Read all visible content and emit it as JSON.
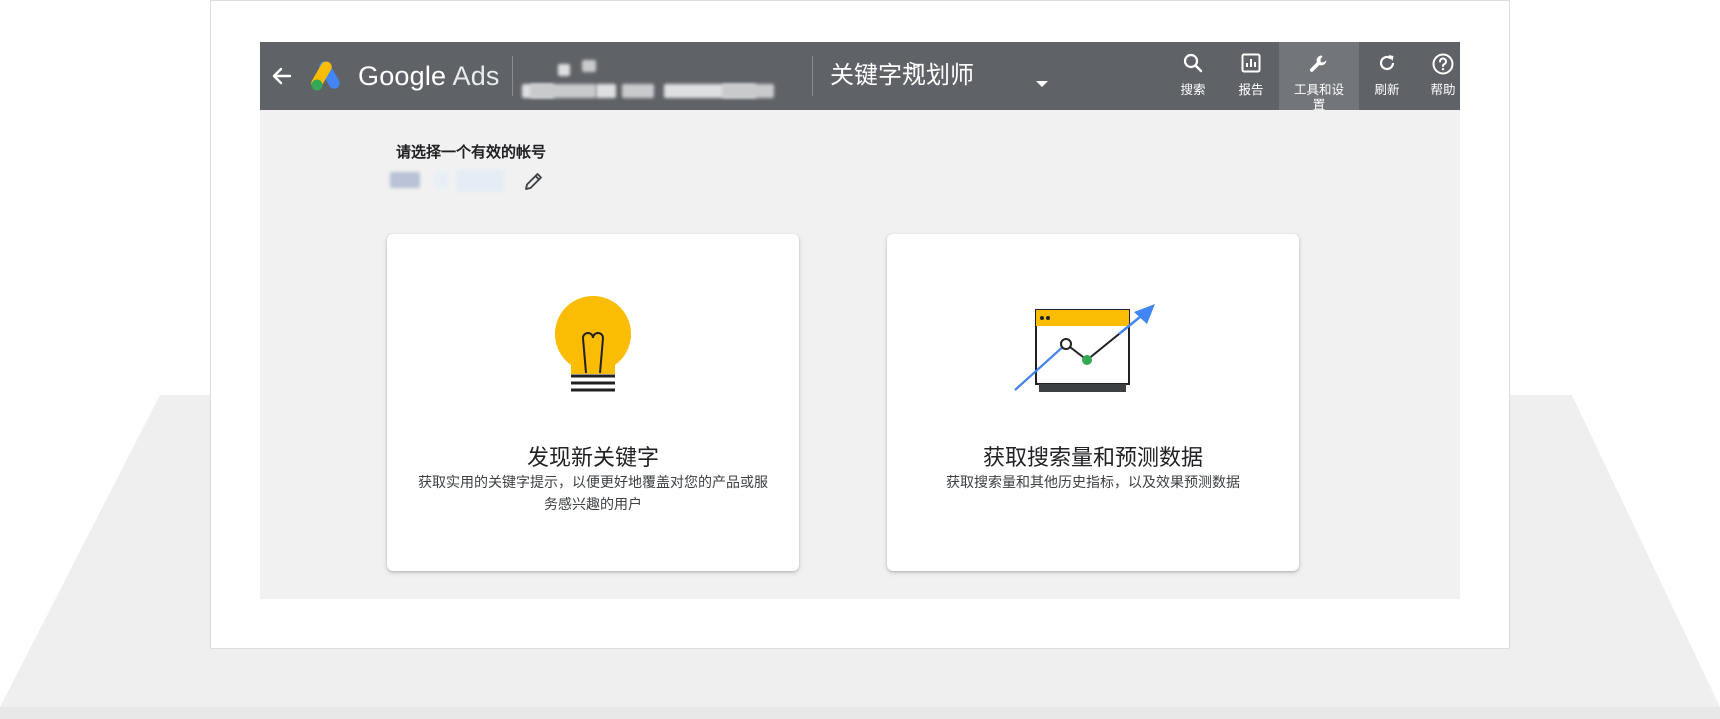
{
  "window": {
    "brand_google": "Google",
    "brand_ads": "Ads",
    "breadcrumb_chevron": ">",
    "page_title": "关键字规划师"
  },
  "nav": [
    {
      "label": "搜索",
      "icon": "search-icon"
    },
    {
      "label": "报告",
      "icon": "reports-icon"
    },
    {
      "label": "工具和设置",
      "icon": "wrench-icon"
    },
    {
      "label": "刷新",
      "icon": "refresh-icon"
    },
    {
      "label": "帮助",
      "icon": "help-icon"
    }
  ],
  "account": {
    "prompt": "请选择一个有效的帐号"
  },
  "cards": [
    {
      "title": "发现新关键字",
      "description": "获取实用的关键字提示，以便更好地覆盖对您的产品或服务感兴趣的用户",
      "icon": "lightbulb-icon"
    },
    {
      "title": "获取搜索量和预测数据",
      "description": "获取搜索量和其他历史指标，以及效果预测数据",
      "icon": "forecast-chart-icon"
    }
  ],
  "colors": {
    "topbar": "#5f6368",
    "accent_yellow": "#fbbc04",
    "accent_blue": "#4285f4",
    "accent_green": "#34a853"
  }
}
